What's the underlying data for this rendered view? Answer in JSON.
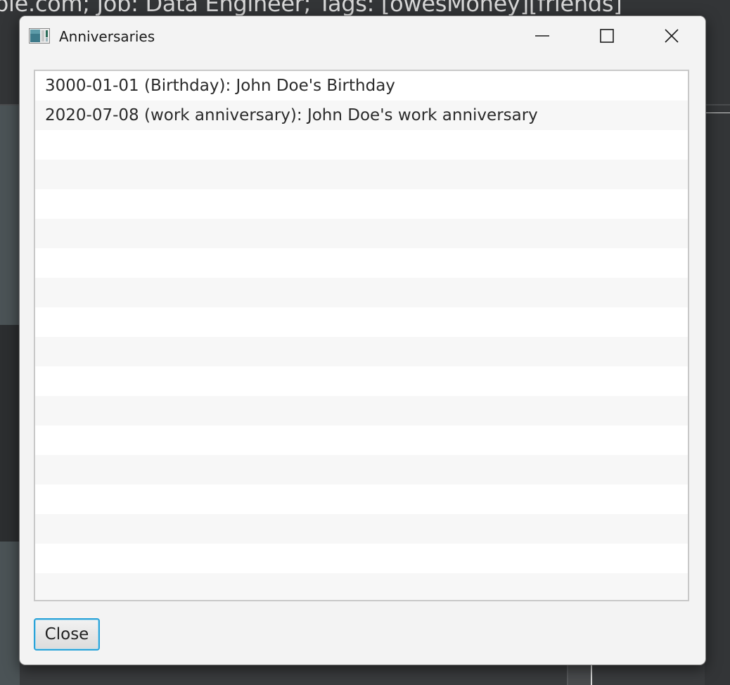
{
  "background_app": {
    "title_fragment": "ple.com; Job: Data Engineer; Tags: [owesMoney][friends]"
  },
  "dialog": {
    "title": "Anniversaries",
    "app_icon": "app-window-icon",
    "controls": {
      "minimize_icon": "minimize-icon",
      "maximize_icon": "maximize-icon",
      "close_icon": "close-icon"
    }
  },
  "anniversaries": [
    "3000-01-01 (Birthday): John Doe's Birthday",
    "2020-07-08 (work anniversary): John Doe's work anniversary",
    "",
    "",
    "",
    "",
    "",
    "",
    "",
    "",
    "",
    "",
    "",
    "",
    "",
    "",
    "",
    ""
  ],
  "footer": {
    "close_label": "Close"
  },
  "colors": {
    "accent": "#2aa3d8",
    "row_alt": "#f7f7f7",
    "dialog_bg": "#f3f3f3"
  }
}
